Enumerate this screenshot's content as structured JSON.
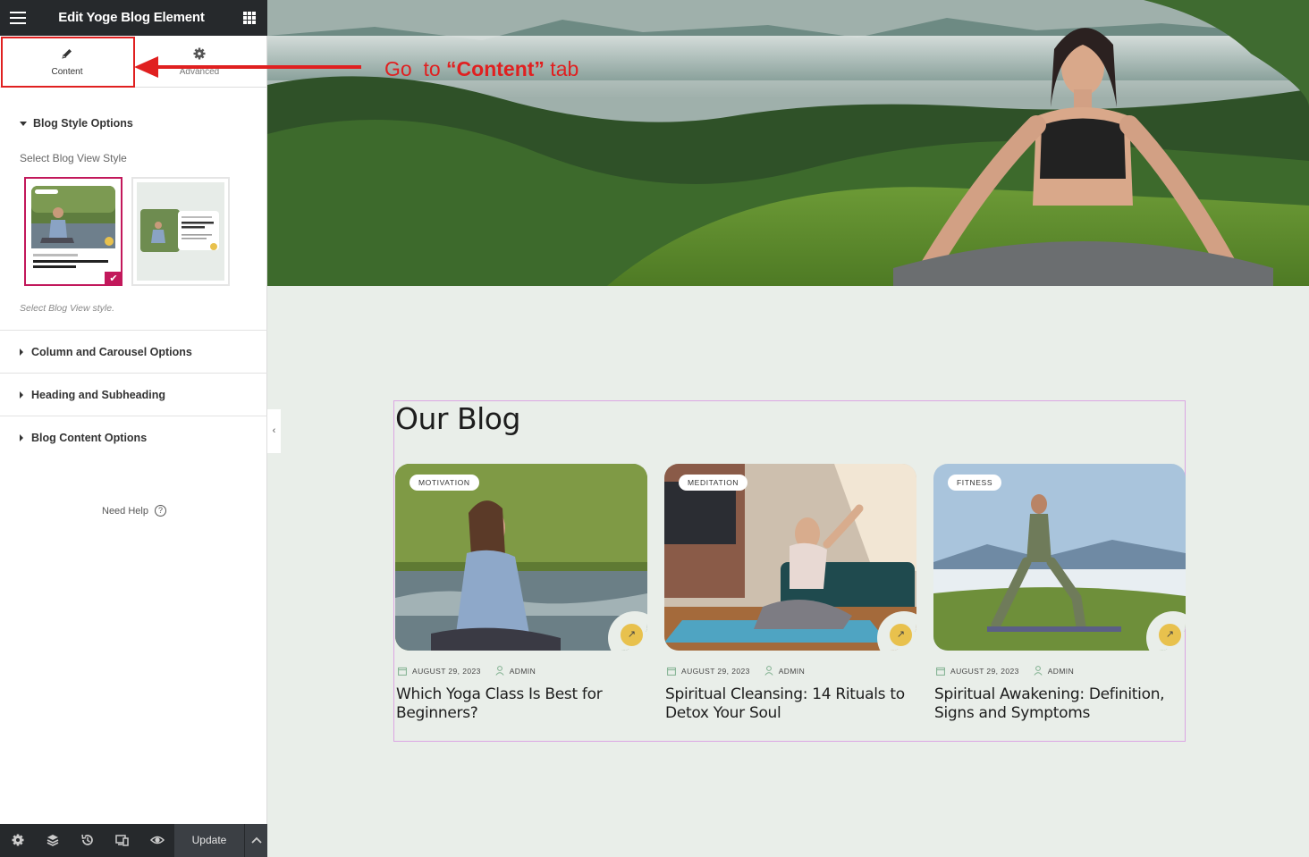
{
  "panel": {
    "title": "Edit Yoge Blog Element",
    "tabs": [
      {
        "label": "Content",
        "icon": "pencil-icon"
      },
      {
        "label": "Advanced",
        "icon": "gear-icon"
      }
    ],
    "sections": {
      "blog_style": {
        "title": "Blog Style Options",
        "field_label": "Select Blog View Style",
        "hint": "Select Blog View style.",
        "selected_style": 1
      },
      "collapsed": [
        "Column and Carousel Options",
        "Heading and Subheading",
        "Blog Content Options"
      ]
    },
    "help_label": "Need Help",
    "footer": {
      "update_label": "Update",
      "icons": [
        "settings-icon",
        "layers-icon",
        "history-icon",
        "responsive-icon",
        "preview-eye-icon"
      ]
    }
  },
  "annotation": {
    "prefix": "Go  to ",
    "emphasis": "“Content”",
    "suffix": " tab",
    "color": "#e02020"
  },
  "blog": {
    "heading": "Our Blog",
    "accent": "#e8c14d",
    "posts": [
      {
        "category": "MOTIVATION",
        "date": "AUGUST 29, 2023",
        "author": "ADMIN",
        "title": "Which Yoga Class Is Best for Beginners?"
      },
      {
        "category": "MEDITATION",
        "date": "AUGUST 29, 2023",
        "author": "ADMIN",
        "title": "Spiritual Cleansing: 14 Rituals to Detox Your Soul"
      },
      {
        "category": "FITNESS",
        "date": "AUGUST 29, 2023",
        "author": "ADMIN",
        "title": "Spiritual Awakening: Definition, Signs and Symptoms"
      }
    ]
  }
}
